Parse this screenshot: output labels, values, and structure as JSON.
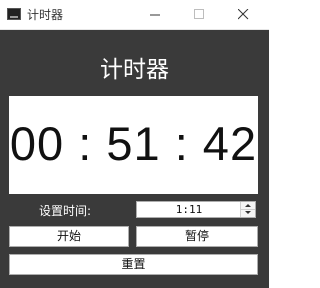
{
  "window": {
    "title": "计时器",
    "icon": "app-icon",
    "controls": [
      "minimize-icon",
      "maximize-icon",
      "close-icon"
    ]
  },
  "main": {
    "heading": "计时器",
    "display": "00 : 51 : 42",
    "set_time_label": "设置时间:",
    "set_time_value": "1:11",
    "start_label": "开始",
    "pause_label": "暂停",
    "reset_label": "重置"
  },
  "colors": {
    "background": "#3a3a3a",
    "display_bg": "#ffffff",
    "text_light": "#ffffff"
  }
}
